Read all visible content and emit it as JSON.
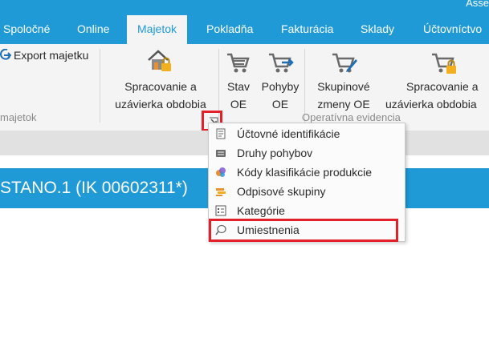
{
  "window": {
    "title_fragment": "Asse"
  },
  "tabs": [
    {
      "label": "Spoločné"
    },
    {
      "label": "Online"
    },
    {
      "label": "Majetok"
    },
    {
      "label": "Pokladňa"
    },
    {
      "label": "Fakturácia"
    },
    {
      "label": "Sklady"
    },
    {
      "label": "Účtovníctvo"
    }
  ],
  "ribbon": {
    "export": {
      "label": "Export majetku"
    },
    "processing": {
      "line1": "Spracovanie a",
      "line2": "uzávierka obdobia"
    },
    "stav": {
      "line1": "Stav",
      "line2": "OE"
    },
    "pohyby": {
      "line1": "Pohyby",
      "line2": "OE"
    },
    "skupinove": {
      "line1": "Skupinové",
      "line2": "zmeny OE"
    },
    "processing2": {
      "line1": "Spracovanie a",
      "line2": "uzávierka obdobia"
    },
    "group_majetok": "majetok",
    "group_operativna": "Operatívna evidencia"
  },
  "banner": {
    "text": "STANO.1 (IK 00602311*)"
  },
  "menu": {
    "items": [
      {
        "label": "Účtovné identifikácie",
        "icon": "document-icon"
      },
      {
        "label": "Druhy pohybov",
        "icon": "list-icon"
      },
      {
        "label": "Kódy klasifikácie produkcie",
        "icon": "classification-icon"
      },
      {
        "label": "Odpisové skupiny",
        "icon": "depreciation-icon"
      },
      {
        "label": "Kategórie",
        "icon": "category-icon"
      },
      {
        "label": "Umiestnenia",
        "icon": "location-icon"
      }
    ]
  },
  "colors": {
    "accent": "#1f9ad6",
    "highlight": "#e3202a"
  }
}
